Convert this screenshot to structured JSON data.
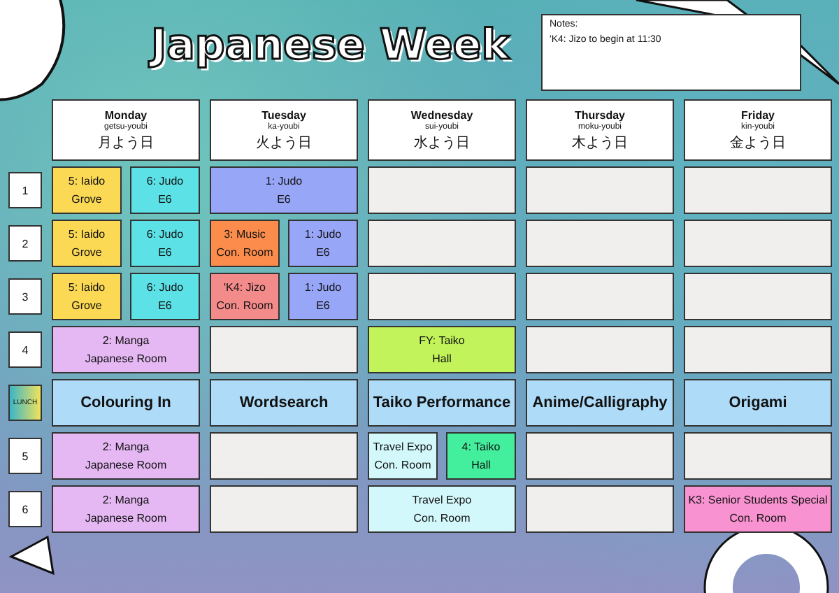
{
  "title": "Japanese Week",
  "notes": {
    "heading": "Notes:",
    "lines": [
      "'K4: Jizo to begin at 11:30"
    ]
  },
  "days": [
    {
      "name": "Monday",
      "romaji": "getsu-youbi",
      "kanji": "月よう日"
    },
    {
      "name": "Tuesday",
      "romaji": "ka-youbi",
      "kanji": "火よう日"
    },
    {
      "name": "Wednesday",
      "romaji": "sui-youbi",
      "kanji": "水よう日"
    },
    {
      "name": "Thursday",
      "romaji": "moku-youbi",
      "kanji": "木よう日"
    },
    {
      "name": "Friday",
      "romaji": "kin-youbi",
      "kanji": "金よう日"
    }
  ],
  "rows": [
    {
      "label": "1",
      "kind": "period",
      "slots": [
        [
          {
            "kind": "session",
            "title": "5: Iaido",
            "room": "Grove",
            "color": "#fcd954"
          },
          {
            "kind": "session",
            "title": "6: Judo",
            "room": "E6",
            "color": "#5ce1e6"
          }
        ],
        [
          {
            "kind": "session",
            "title": "1: Judo",
            "room": "E6",
            "color": "#97a6f7"
          }
        ],
        [
          {
            "kind": "empty"
          }
        ],
        [
          {
            "kind": "empty"
          }
        ],
        [
          {
            "kind": "empty"
          }
        ]
      ]
    },
    {
      "label": "2",
      "kind": "period",
      "slots": [
        [
          {
            "kind": "session",
            "title": "5: Iaido",
            "room": "Grove",
            "color": "#fcd954"
          },
          {
            "kind": "session",
            "title": "6: Judo",
            "room": "E6",
            "color": "#5ce1e6"
          }
        ],
        [
          {
            "kind": "session",
            "title": "3: Music",
            "room": "Con. Room",
            "color": "#fb8c4c"
          },
          {
            "kind": "session",
            "title": "1: Judo",
            "room": "E6",
            "color": "#97a6f7"
          }
        ],
        [
          {
            "kind": "empty"
          }
        ],
        [
          {
            "kind": "empty"
          }
        ],
        [
          {
            "kind": "empty"
          }
        ]
      ]
    },
    {
      "label": "3",
      "kind": "period",
      "slots": [
        [
          {
            "kind": "session",
            "title": "5: Iaido",
            "room": "Grove",
            "color": "#fcd954"
          },
          {
            "kind": "session",
            "title": "6: Judo",
            "room": "E6",
            "color": "#5ce1e6"
          }
        ],
        [
          {
            "kind": "session",
            "title": "'K4: Jizo",
            "room": "Con. Room",
            "color": "#f48b8b"
          },
          {
            "kind": "session",
            "title": "1: Judo",
            "room": "E6",
            "color": "#97a6f7"
          }
        ],
        [
          {
            "kind": "empty"
          }
        ],
        [
          {
            "kind": "empty"
          }
        ],
        [
          {
            "kind": "empty"
          }
        ]
      ]
    },
    {
      "label": "4",
      "kind": "period",
      "slots": [
        [
          {
            "kind": "session",
            "title": "2: Manga",
            "room": "Japanese Room",
            "color": "#e5b8f4"
          }
        ],
        [
          {
            "kind": "empty"
          }
        ],
        [
          {
            "kind": "session",
            "title": "FY: Taiko",
            "room": "Hall",
            "color": "#c2f35a"
          }
        ],
        [
          {
            "kind": "empty"
          }
        ],
        [
          {
            "kind": "empty"
          }
        ]
      ]
    },
    {
      "label": "LUNCH",
      "kind": "lunch",
      "slots": [
        [
          {
            "kind": "activity",
            "title": "Colouring In",
            "color": "#aedcf8"
          }
        ],
        [
          {
            "kind": "activity",
            "title": "Wordsearch",
            "color": "#aedcf8"
          }
        ],
        [
          {
            "kind": "activity",
            "title": "Taiko Performance",
            "color": "#aedcf8"
          }
        ],
        [
          {
            "kind": "activity",
            "title": "Anime/Calligraphy",
            "color": "#aedcf8"
          }
        ],
        [
          {
            "kind": "activity",
            "title": "Origami",
            "color": "#aedcf8"
          }
        ]
      ]
    },
    {
      "label": "5",
      "kind": "period",
      "slots": [
        [
          {
            "kind": "session",
            "title": "2: Manga",
            "room": "Japanese Room",
            "color": "#e5b8f4"
          }
        ],
        [
          {
            "kind": "empty"
          }
        ],
        [
          {
            "kind": "session",
            "title": "Travel Expo",
            "room": "Con. Room",
            "color": "#d3f8fb"
          },
          {
            "kind": "session",
            "title": "4: Taiko",
            "room": "Hall",
            "color": "#43ee9c"
          }
        ],
        [
          {
            "kind": "empty"
          }
        ],
        [
          {
            "kind": "empty"
          }
        ]
      ]
    },
    {
      "label": "6",
      "kind": "period",
      "slots": [
        [
          {
            "kind": "session",
            "title": "2: Manga",
            "room": "Japanese Room",
            "color": "#e5b8f4"
          }
        ],
        [
          {
            "kind": "empty"
          }
        ],
        [
          {
            "kind": "session",
            "title": "Travel Expo",
            "room": "Con. Room",
            "color": "#d3f8fb"
          }
        ],
        [
          {
            "kind": "empty"
          }
        ],
        [
          {
            "kind": "session",
            "title": "K3: Senior Students Special",
            "room": "Con. Room",
            "color": "#f892d0"
          }
        ]
      ]
    }
  ]
}
